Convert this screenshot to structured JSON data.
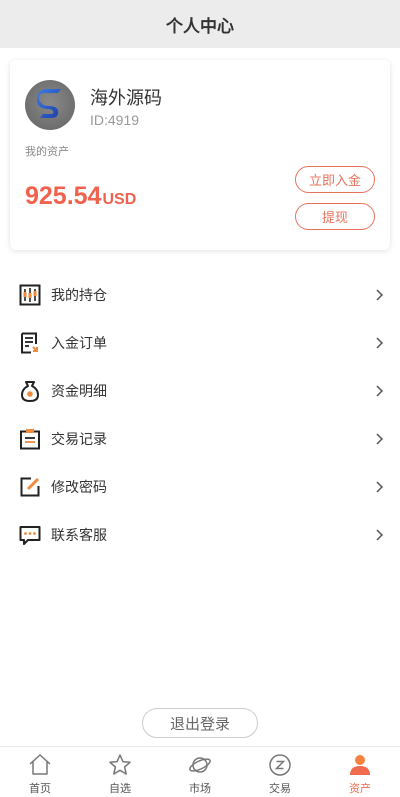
{
  "header": {
    "title": "个人中心"
  },
  "profile": {
    "name": "海外源码",
    "id": "ID:4919",
    "asset_label": "我的资产",
    "balance": "925.54",
    "currency": "USD",
    "deposit_label": "立即入金",
    "withdraw_label": "提现"
  },
  "menu": [
    {
      "label": "我的持仓",
      "icon": "holdings-icon"
    },
    {
      "label": "入金订单",
      "icon": "deposit-order-icon"
    },
    {
      "label": "资金明细",
      "icon": "money-bag-icon"
    },
    {
      "label": "交易记录",
      "icon": "clipboard-icon"
    },
    {
      "label": "修改密码",
      "icon": "edit-icon"
    },
    {
      "label": "联系客服",
      "icon": "chat-icon"
    }
  ],
  "logout_label": "退出登录",
  "tabs": [
    {
      "label": "首页",
      "icon": "home-icon",
      "active": false
    },
    {
      "label": "自选",
      "icon": "star-icon",
      "active": false
    },
    {
      "label": "市场",
      "icon": "planet-icon",
      "active": false
    },
    {
      "label": "交易",
      "icon": "trade-icon",
      "active": false
    },
    {
      "label": "资产",
      "icon": "user-icon",
      "active": true
    }
  ],
  "colors": {
    "accent": "#f0624e",
    "icon_orange": "#f08a3c",
    "header_bg": "#ececec"
  }
}
